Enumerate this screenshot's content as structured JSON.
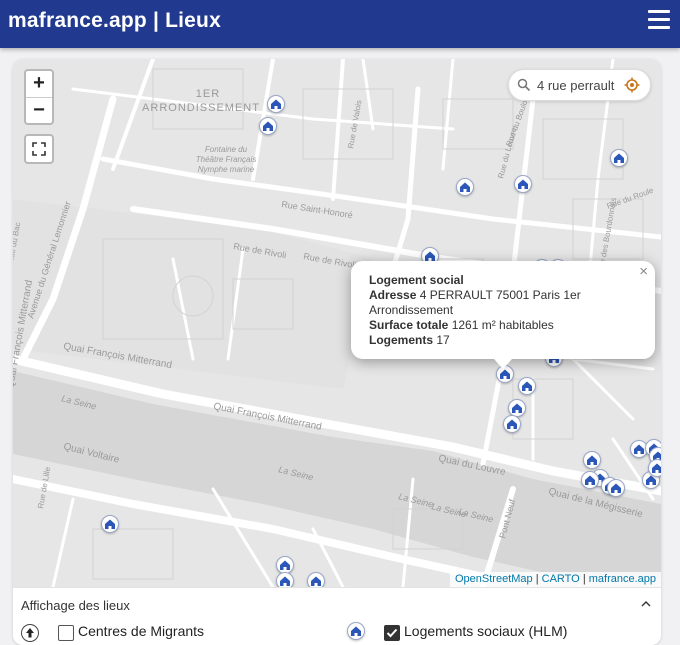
{
  "header": {
    "title": "mafrance.app | Lieux",
    "menu_icon": "hamburger-menu-icon"
  },
  "map": {
    "zoom_in_label": "+",
    "zoom_out_label": "−",
    "search": {
      "value": "4 rue perrault",
      "placeholder": ""
    },
    "labels": {
      "district_line1": "1ER",
      "district_line2": "ARRONDISSEMENT",
      "theatre_line1": "Fontaine du",
      "theatre_line2": "Théâtre Français",
      "theatre_line3": "Nymphe marine",
      "avenue": "Avenue du Général Lemonnier",
      "rue_saint_honore": "Rue Saint-Honoré",
      "rue_de_rivoli_1": "Rue de Rivoli",
      "rue_de_rivoli_2": "Rue de Rivoli",
      "quai_fm_1": "Quai François Mitterrand",
      "quai_fm_2": "Quai François Mitterrand",
      "quai_fm_3": "Quai François Mitterrand",
      "quai_du_louvre": "Quai du Louvre",
      "quai_megisserie": "Quai de la Mégisserie",
      "quai_voltaire": "Quai Voltaire",
      "pont_neuf": "Pont Neuf",
      "la_seine_1": "La Seine",
      "la_seine_2": "La Seine",
      "la_seine_3": "La Seine",
      "la_seine_4": "La Seine",
      "la_seine_5": "La Seine",
      "rue_du_bac": "Rue du Bac",
      "rue_de_lille": "Rue de Lille",
      "rue_du_louvre": "Rue du Louvre",
      "rue_de_valois": "Rue de Valois",
      "rue_du_bouloi": "Rue du Bouloi",
      "rue_du_roule": "Rue du Roule",
      "rue_des_bourdonnais": "Rue des Bourdonnais"
    },
    "popup": {
      "title": "Logement social",
      "address_label": "Adresse",
      "address_value": "4 PERRAULT 75001 Paris 1er Arrondissement",
      "surface_label": "Surface totale",
      "surface_value": "1261 m² habitables",
      "logements_label": "Logements",
      "logements_value": "17",
      "close": "×"
    },
    "attribution": {
      "osm": "OpenStreetMap",
      "sep": "|",
      "carto": "CARTO",
      "app": "mafrance.app"
    },
    "marker_icon": "social-housing-icon",
    "marker_color": "#2a57b8"
  },
  "legend": {
    "header": "Affichage des lieux",
    "items": [
      {
        "label": "Centres de Migrants",
        "checked": false
      },
      {
        "label": "Logements sociaux (HLM)",
        "checked": true
      }
    ]
  },
  "colors": {
    "header_bg": "#213a8f",
    "map_bg": "#e9e9e9",
    "water": "#d6d6d6",
    "link": "#0078a8"
  }
}
